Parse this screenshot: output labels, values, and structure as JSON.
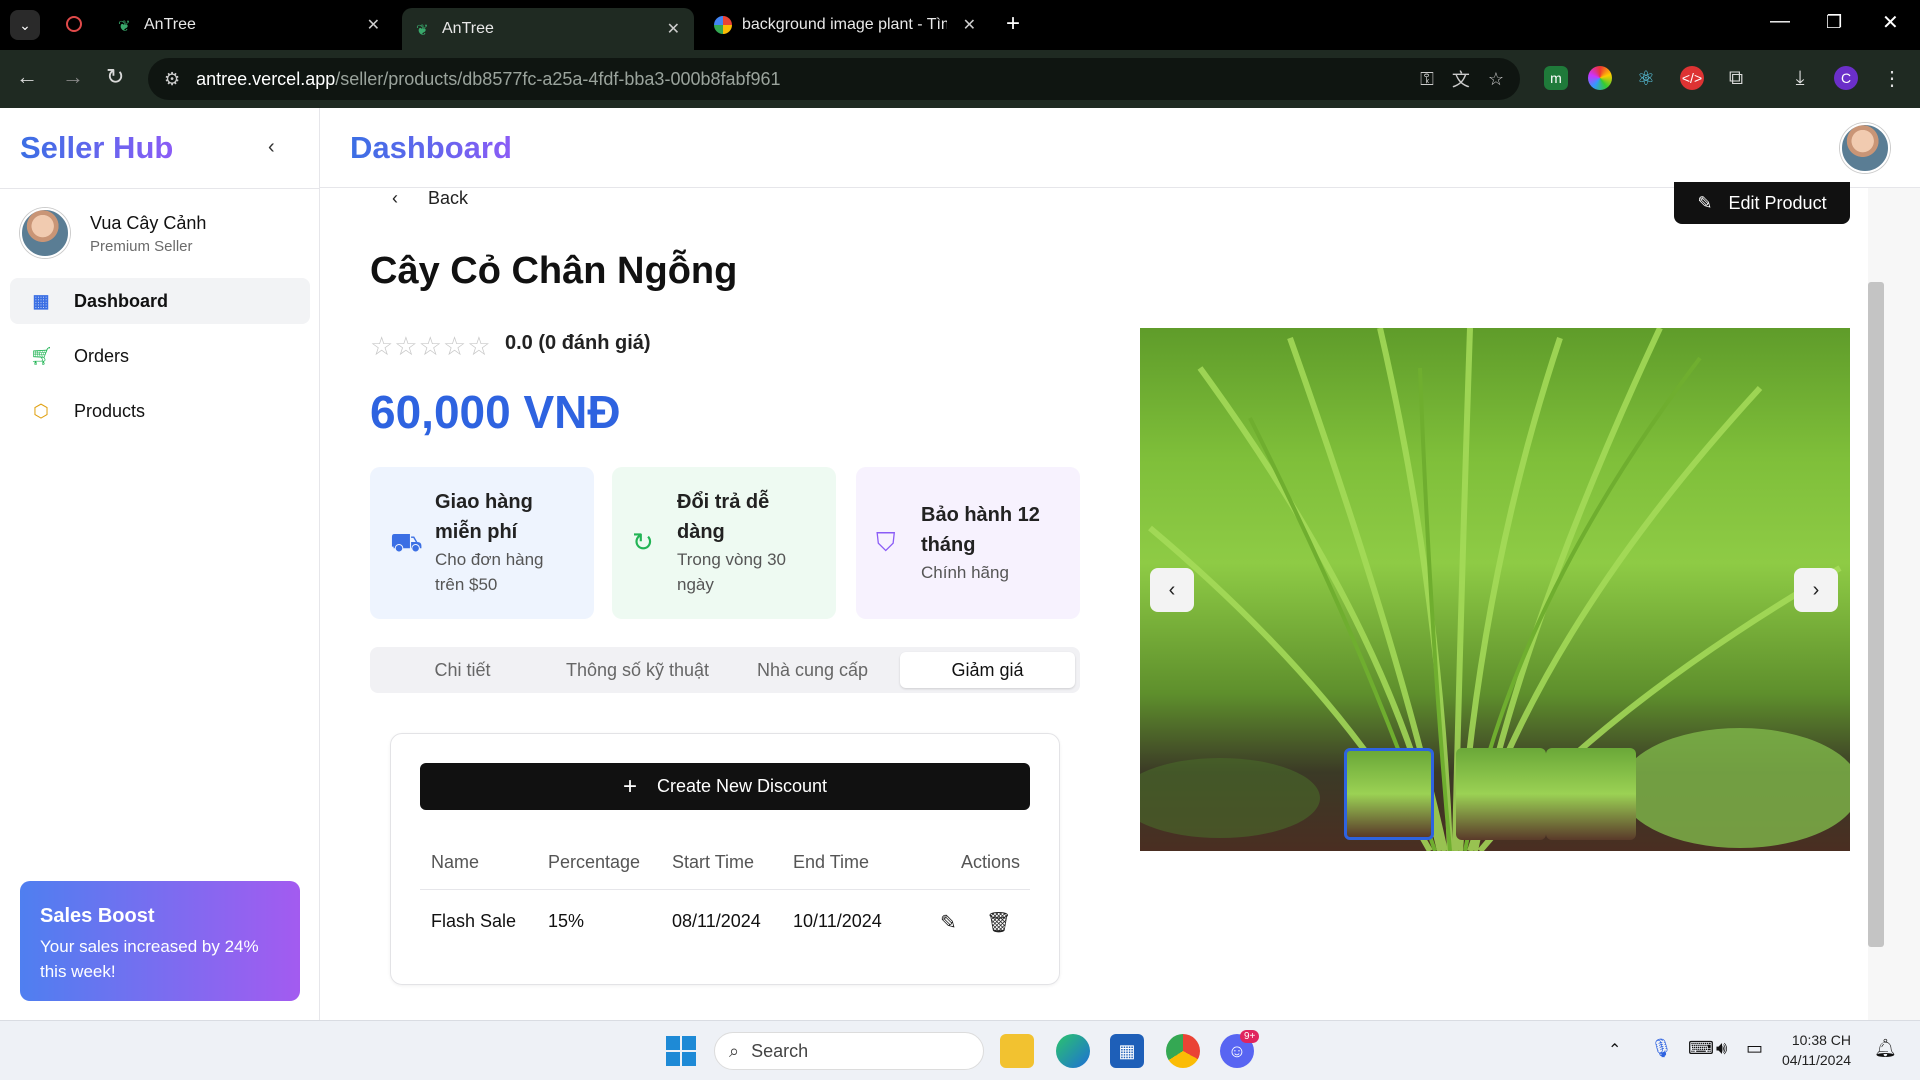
{
  "browser": {
    "tabs": [
      {
        "title": "AnTree",
        "active": false
      },
      {
        "title": "AnTree",
        "active": true
      },
      {
        "title": "background image plant - Tìm t",
        "active": false
      }
    ],
    "url_host": "antree.vercel.app",
    "url_path": "/seller/products/db8577fc-a25a-4fdf-bba3-000b8fabf961",
    "profile_letter": "C"
  },
  "sidebar": {
    "brand": "Seller Hub",
    "user_name": "Vua Cây Cảnh",
    "user_role": "Premium Seller",
    "items": [
      {
        "label": "Dashboard",
        "icon": "dashboard-grid-icon",
        "active": true
      },
      {
        "label": "Orders",
        "icon": "cart-icon",
        "active": false
      },
      {
        "label": "Products",
        "icon": "box-icon",
        "active": false
      }
    ],
    "boost_title": "Sales Boost",
    "boost_desc": "Your sales increased by 24% this week!"
  },
  "header": {
    "title": "Dashboard"
  },
  "product": {
    "back_label": "Back",
    "edit_label": "Edit Product",
    "name": "Cây Cỏ Chân Ngỗng",
    "rating_stars": 0,
    "rating_text": "0.0 (0 đánh giá)",
    "price": "60,000 VNĐ",
    "features": [
      {
        "title": "Giao hàng miễn phí",
        "desc": "Cho đơn hàng trên $50",
        "color": "#eef4fe",
        "icon": "truck-icon",
        "icon_color": "#3b6fe4"
      },
      {
        "title": "Đổi trả dễ dàng",
        "desc": "Trong vòng 30 ngày",
        "color": "#eefaf2",
        "icon": "refresh-icon",
        "icon_color": "#22b455"
      },
      {
        "title": "Bảo hành 12 tháng",
        "desc": "Chính hãng",
        "color": "#f7f2fe",
        "icon": "shield-icon",
        "icon_color": "#8b5cf6"
      }
    ],
    "tabs": [
      "Chi tiết",
      "Thông số kỹ thuật",
      "Nhà cung cấp",
      "Giảm giá"
    ],
    "selected_tab": "Giảm giá"
  },
  "discounts": {
    "create_label": "Create New Discount",
    "columns": [
      "Name",
      "Percentage",
      "Start Time",
      "End Time",
      "Actions"
    ],
    "rows": [
      {
        "name": "Flash Sale",
        "percentage": "15%",
        "start": "08/11/2024",
        "end": "10/11/2024"
      }
    ]
  },
  "taskbar": {
    "search_placeholder": "Search",
    "time": "10:38 CH",
    "date": "04/11/2024",
    "badge": "9+"
  }
}
